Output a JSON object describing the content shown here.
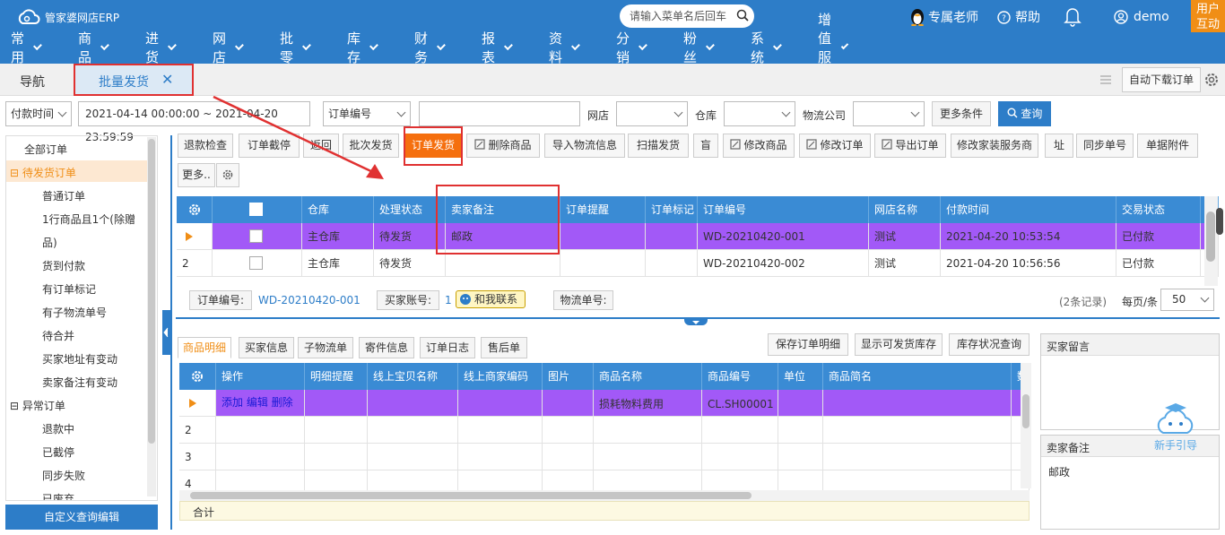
{
  "header": {
    "logo_text": "管家婆网店ERP",
    "search_placeholder": "请输入菜单名后回车",
    "expert": "专属老师",
    "help": "帮助",
    "user": "demo",
    "user_interact_line1": "用户",
    "user_interact_line2": "互动",
    "accent": "#2d7dc8"
  },
  "menu": [
    "常用",
    "商品",
    "进货",
    "网店",
    "批零",
    "库存",
    "财务",
    "报表",
    "资料",
    "分销",
    "粉丝",
    "系统",
    "增值服务"
  ],
  "tabs": {
    "nav": "导航",
    "active": "批量发货",
    "close": "✕",
    "auto_download": "自动下载订单"
  },
  "filters": {
    "time_type": "付款时间",
    "date_range": "2021-04-14 00:00:00 ~ 2021-04-20 23:59:59",
    "field_type": "订单编号",
    "shop_label": "网店",
    "warehouse_label": "仓库",
    "logistics_label": "物流公司",
    "more_conditions": "更多条件",
    "query": "查询"
  },
  "sidebar": {
    "items": [
      {
        "label": "全部订单",
        "level": 0
      },
      {
        "label": "待发货订单",
        "level": 0,
        "prefix": "⊟",
        "active": true
      },
      {
        "label": "普通订单",
        "level": 1
      },
      {
        "label": "1行商品且1个(除赠",
        "level": 1
      },
      {
        "label": "品)",
        "level": 1
      },
      {
        "label": "货到付款",
        "level": 1
      },
      {
        "label": "有订单标记",
        "level": 1
      },
      {
        "label": "有子物流单号",
        "level": 1
      },
      {
        "label": "待合并",
        "level": 1
      },
      {
        "label": "买家地址有变动",
        "level": 1
      },
      {
        "label": "卖家备注有变动",
        "level": 1
      },
      {
        "label": "异常订单",
        "level": 0,
        "prefix": "⊟"
      },
      {
        "label": "退款中",
        "level": 1
      },
      {
        "label": "已截停",
        "level": 1
      },
      {
        "label": "同步失败",
        "level": 1
      },
      {
        "label": "已废弃",
        "level": 1
      }
    ],
    "custom_query": "自定义查询编辑"
  },
  "toolbar": {
    "row1": [
      "退款检查",
      "订单截停",
      "返回",
      "批次发货",
      "订单发货",
      "删除商品",
      "导入物流信息",
      "扫描发货",
      "盲",
      "修改商品",
      "修改订单",
      "导出订单",
      "修改家装服务商",
      "址",
      "同步单号",
      "单据附件"
    ],
    "more": "更多.."
  },
  "grid": {
    "headers": [
      "仓库",
      "处理状态",
      "卖家备注",
      "订单提醒",
      "订单标记",
      "订单编号",
      "网店名称",
      "付款时间",
      "交易状态",
      "同"
    ],
    "rows": [
      {
        "num": "",
        "warehouse": "主仓库",
        "status": "待发货",
        "seller_note": "邮政",
        "order_no": "WD-20210420-001",
        "shop": "测试",
        "pay_time": "2021-04-20 10:53:54",
        "trade_status": "已付款"
      },
      {
        "num": "2",
        "warehouse": "主仓库",
        "status": "待发货",
        "seller_note": "",
        "order_no": "WD-20210420-002",
        "shop": "测试",
        "pay_time": "2021-04-20 10:56:56",
        "trade_status": "已付款"
      }
    ],
    "row_highlight": "#a259f7"
  },
  "infobar": {
    "order_no_label": "订单编号:",
    "order_no": "WD-20210420-001",
    "buyer_label": "买家账号:",
    "buyer": "1",
    "contact": "和我联系",
    "logistics_label": "物流单号:",
    "records": "(2条记录)",
    "per_page_label": "每页/条",
    "per_page": "50"
  },
  "lower": {
    "tabs": [
      "商品明细",
      "买家信息",
      "子物流单",
      "寄件信息",
      "订单日志",
      "售后单"
    ],
    "actions": [
      "保存订单明细",
      "显示可发货库存",
      "库存状况查询"
    ],
    "headers": [
      "操作",
      "明细提醒",
      "线上宝贝名称",
      "线上商家编码",
      "图片",
      "商品名称",
      "商品编号",
      "单位",
      "商品简名",
      "数"
    ],
    "row1": {
      "ops": "添加 编辑 删除",
      "name": "损耗物料费用",
      "code": "CL.SH00001"
    },
    "row_nums": [
      "2",
      "3",
      "4"
    ],
    "total": "合计"
  },
  "right": {
    "buyer_msg": "买家留言",
    "seller_note": "卖家备注",
    "seller_note_value": "邮政",
    "guide": "新手引导"
  }
}
